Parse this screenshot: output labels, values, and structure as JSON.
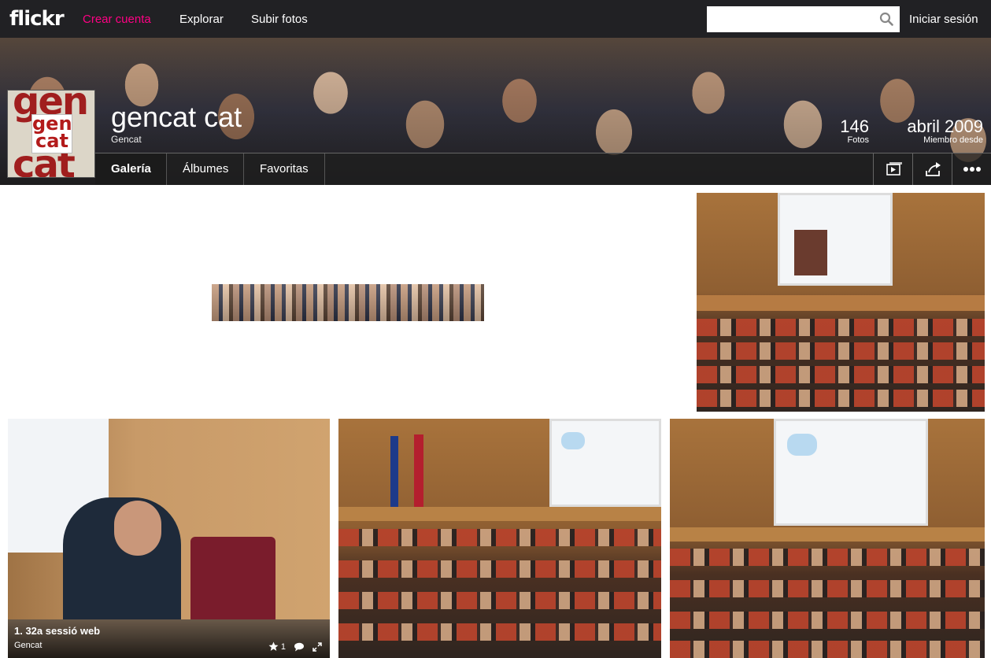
{
  "topnav": {
    "logo": "flickr",
    "create_account": "Crear cuenta",
    "explore": "Explorar",
    "upload": "Subir fotos",
    "search_placeholder": "",
    "signin": "Iniciar sesión"
  },
  "profile": {
    "avatar_text": [
      "gen",
      "cat"
    ],
    "username": "gencat cat",
    "realname": "Gencat",
    "photos_count": "146",
    "photos_label": "Fotos",
    "member_since": "abril 2009",
    "member_since_label": "Miembro desde"
  },
  "tabs": [
    {
      "label": "Galería",
      "active": true
    },
    {
      "label": "Álbumes",
      "active": false
    },
    {
      "label": "Favoritas",
      "active": false
    }
  ],
  "photos": [
    {
      "title": "1. 32a sessió web",
      "owner": "Gencat",
      "faves": "1"
    }
  ],
  "colors": {
    "nav_bg": "#212124",
    "accent": "#ff0084"
  }
}
